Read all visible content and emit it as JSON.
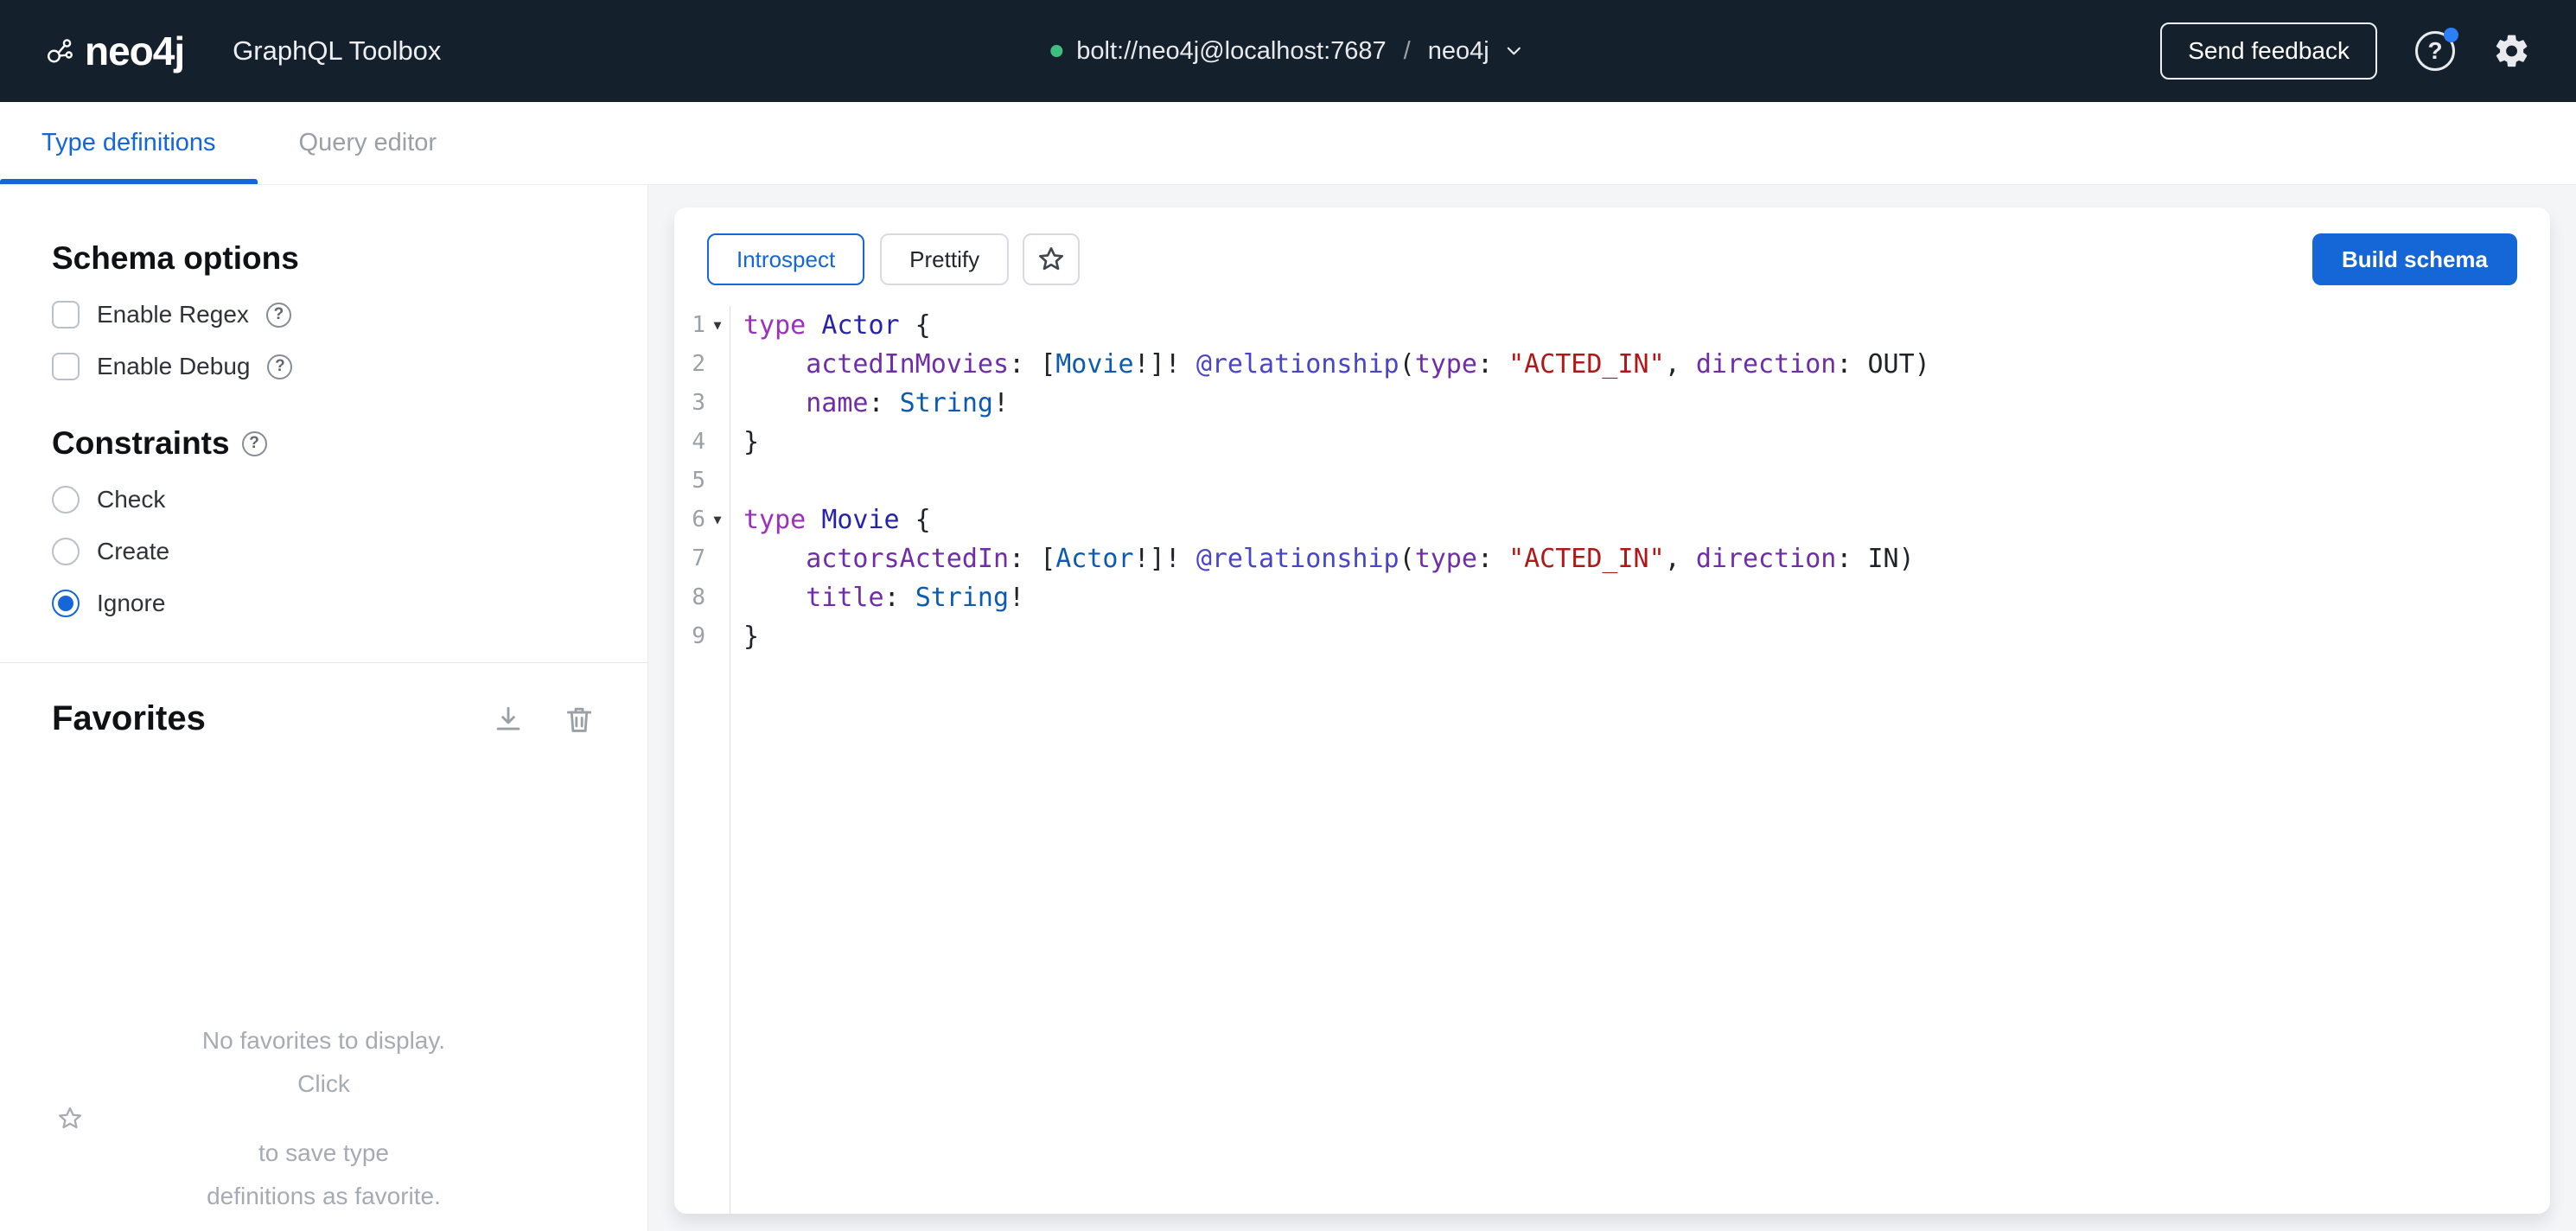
{
  "navbar": {
    "logo_text": "neo4j",
    "app_title": "GraphQL Toolbox",
    "connection": {
      "url": "bolt://neo4j@localhost:7687",
      "separator": "/",
      "database": "neo4j"
    },
    "send_feedback_label": "Send feedback"
  },
  "tabs": [
    {
      "label": "Type definitions",
      "active": true
    },
    {
      "label": "Query editor",
      "active": false
    }
  ],
  "sidebar": {
    "schema_options": {
      "title": "Schema options",
      "checkboxes": [
        {
          "label": "Enable Regex",
          "checked": false
        },
        {
          "label": "Enable Debug",
          "checked": false
        }
      ]
    },
    "constraints": {
      "title": "Constraints",
      "options": [
        {
          "label": "Check",
          "selected": false
        },
        {
          "label": "Create",
          "selected": false
        },
        {
          "label": "Ignore",
          "selected": true
        }
      ]
    },
    "favorites": {
      "title": "Favorites",
      "empty_line1": "No favorites to display.",
      "empty_line2_prefix": "Click",
      "empty_line2_suffix": "to save type",
      "empty_line3": "definitions as favorite."
    }
  },
  "editor": {
    "toolbar": {
      "introspect_label": "Introspect",
      "prettify_label": "Prettify",
      "build_schema_label": "Build schema"
    },
    "lines": [
      {
        "num": 1,
        "fold": true,
        "tokens": [
          {
            "t": "type",
            "c": "keyword"
          },
          {
            "t": " ",
            "c": "plain"
          },
          {
            "t": "Actor",
            "c": "typeName"
          },
          {
            "t": " {",
            "c": "punct"
          }
        ]
      },
      {
        "num": 2,
        "fold": false,
        "tokens": [
          {
            "t": "    ",
            "c": "plain"
          },
          {
            "t": "actedInMovies",
            "c": "property"
          },
          {
            "t": ":",
            "c": "punct"
          },
          {
            "t": " ",
            "c": "plain"
          },
          {
            "t": "[",
            "c": "punct"
          },
          {
            "t": "Movie",
            "c": "atom"
          },
          {
            "t": "!]!",
            "c": "punct"
          },
          {
            "t": " ",
            "c": "plain"
          },
          {
            "t": "@relationship",
            "c": "directive"
          },
          {
            "t": "(",
            "c": "punct"
          },
          {
            "t": "type",
            "c": "property"
          },
          {
            "t": ":",
            "c": "punct"
          },
          {
            "t": " ",
            "c": "plain"
          },
          {
            "t": "\"ACTED_IN\"",
            "c": "string"
          },
          {
            "t": ",",
            "c": "punct"
          },
          {
            "t": " ",
            "c": "plain"
          },
          {
            "t": "direction",
            "c": "property"
          },
          {
            "t": ":",
            "c": "punct"
          },
          {
            "t": " ",
            "c": "plain"
          },
          {
            "t": "OUT",
            "c": "plain"
          },
          {
            "t": ")",
            "c": "punct"
          }
        ]
      },
      {
        "num": 3,
        "fold": false,
        "tokens": [
          {
            "t": "    ",
            "c": "plain"
          },
          {
            "t": "name",
            "c": "property"
          },
          {
            "t": ":",
            "c": "punct"
          },
          {
            "t": " ",
            "c": "plain"
          },
          {
            "t": "String",
            "c": "atom"
          },
          {
            "t": "!",
            "c": "punct"
          }
        ]
      },
      {
        "num": 4,
        "fold": false,
        "tokens": [
          {
            "t": "}",
            "c": "punct"
          }
        ]
      },
      {
        "num": 5,
        "fold": false,
        "tokens": []
      },
      {
        "num": 6,
        "fold": true,
        "tokens": [
          {
            "t": "type",
            "c": "keyword"
          },
          {
            "t": " ",
            "c": "plain"
          },
          {
            "t": "Movie",
            "c": "typeName"
          },
          {
            "t": " {",
            "c": "punct"
          }
        ]
      },
      {
        "num": 7,
        "fold": false,
        "tokens": [
          {
            "t": "    ",
            "c": "plain"
          },
          {
            "t": "actorsActedIn",
            "c": "property"
          },
          {
            "t": ":",
            "c": "punct"
          },
          {
            "t": " ",
            "c": "plain"
          },
          {
            "t": "[",
            "c": "punct"
          },
          {
            "t": "Actor",
            "c": "atom"
          },
          {
            "t": "!]!",
            "c": "punct"
          },
          {
            "t": " ",
            "c": "plain"
          },
          {
            "t": "@relationship",
            "c": "directive"
          },
          {
            "t": "(",
            "c": "punct"
          },
          {
            "t": "type",
            "c": "property"
          },
          {
            "t": ":",
            "c": "punct"
          },
          {
            "t": " ",
            "c": "plain"
          },
          {
            "t": "\"ACTED_IN\"",
            "c": "string"
          },
          {
            "t": ",",
            "c": "punct"
          },
          {
            "t": " ",
            "c": "plain"
          },
          {
            "t": "direction",
            "c": "property"
          },
          {
            "t": ":",
            "c": "punct"
          },
          {
            "t": " ",
            "c": "plain"
          },
          {
            "t": "IN",
            "c": "plain"
          },
          {
            "t": ")",
            "c": "punct"
          }
        ]
      },
      {
        "num": 8,
        "fold": false,
        "tokens": [
          {
            "t": "    ",
            "c": "plain"
          },
          {
            "t": "title",
            "c": "property"
          },
          {
            "t": ":",
            "c": "punct"
          },
          {
            "t": " ",
            "c": "plain"
          },
          {
            "t": "String",
            "c": "atom"
          },
          {
            "t": "!",
            "c": "punct"
          }
        ]
      },
      {
        "num": 9,
        "fold": false,
        "tokens": [
          {
            "t": "}",
            "c": "punct"
          }
        ]
      }
    ]
  },
  "colors": {
    "accent_blue": "#1566D6",
    "navbar_bg": "#14202B",
    "status_green": "#3FBF7F",
    "notification_blue": "#2D7FF9",
    "main_bg": "#F4F5F7",
    "syntax": {
      "keyword": "#9B2FBE",
      "type_name": "#2723A8",
      "property": "#6F2DA8",
      "atom": "#0C5BB0",
      "directive": "#4845C8",
      "string": "#B01818"
    }
  },
  "icons": {
    "logo": "neo4j-graph-mark",
    "dropdown": "chevron-down",
    "help": "question-circle",
    "settings": "gear",
    "download": "download-tray",
    "delete": "trash",
    "favorite": "star-outline",
    "fold": "triangle-down",
    "status": "green-dot"
  }
}
